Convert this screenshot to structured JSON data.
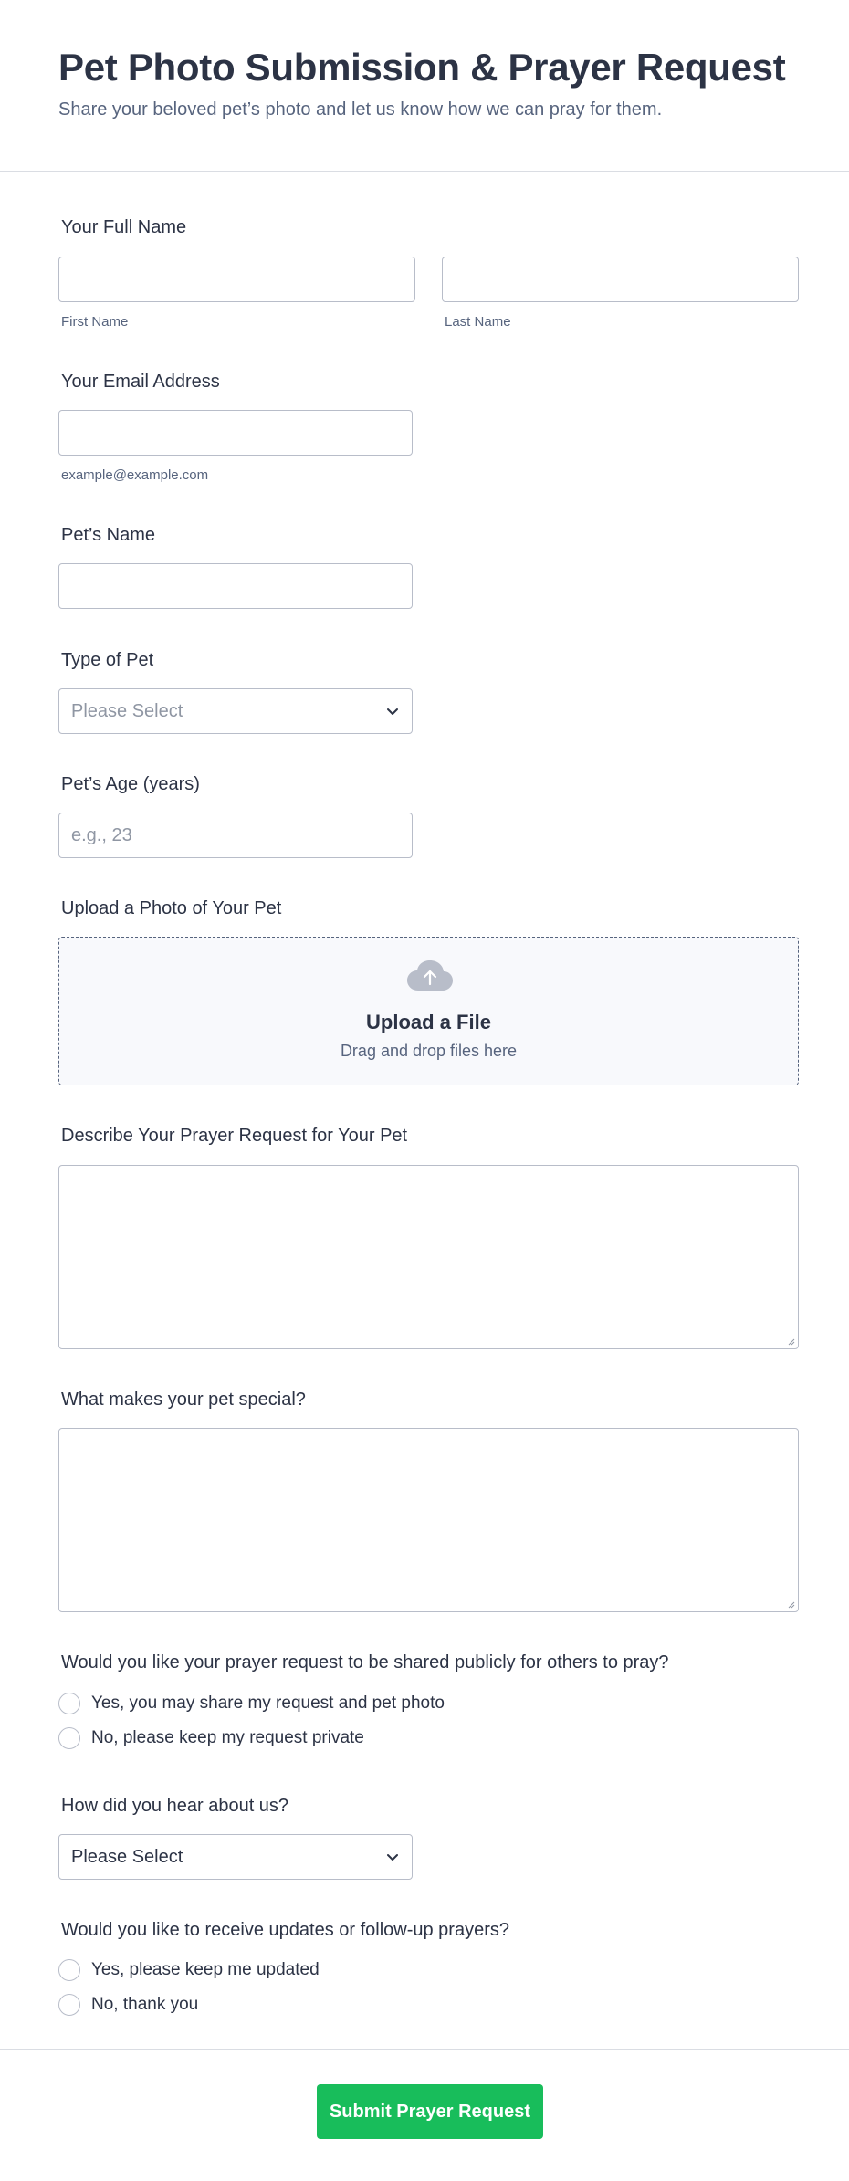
{
  "header": {
    "title": "Pet Photo Submission & Prayer Request",
    "subtitle": "Share your beloved pet’s photo and let us know how we can pray for them."
  },
  "full_name": {
    "label": "Your Full Name",
    "first_value": "",
    "first_sublabel": "First Name",
    "last_value": "",
    "last_sublabel": "Last Name"
  },
  "email": {
    "label": "Your Email Address",
    "value": "",
    "sublabel": "example@example.com"
  },
  "pet_name": {
    "label": "Pet’s Name",
    "value": ""
  },
  "pet_type": {
    "label": "Type of Pet",
    "selected": "Please Select"
  },
  "pet_age": {
    "label": "Pet’s Age (years)",
    "placeholder": "e.g., 23"
  },
  "upload": {
    "label": "Upload a Photo of Your Pet",
    "title": "Upload a File",
    "hint": "Drag and drop files here",
    "icon": "cloud-upload-icon"
  },
  "prayer_request": {
    "label": "Describe Your Prayer Request for Your Pet",
    "value": ""
  },
  "special": {
    "label": "What makes your pet special?",
    "value": ""
  },
  "share_publicly": {
    "label": "Would you like your prayer request to be shared publicly for others to pray?",
    "options": [
      "Yes, you may share my request and pet photo",
      "No, please keep my request private"
    ]
  },
  "referral": {
    "label": "How did you hear about us?",
    "selected": "Please Select"
  },
  "updates": {
    "label": "Would you like to receive updates or follow-up prayers?",
    "options": [
      "Yes, please keep me updated",
      "No, thank you"
    ]
  },
  "footer": {
    "submit_label": "Submit Prayer Request"
  },
  "colors": {
    "accent": "#18bd5b",
    "text": "#2c3345",
    "muted": "#57647e",
    "border": "#b8bdc9"
  }
}
